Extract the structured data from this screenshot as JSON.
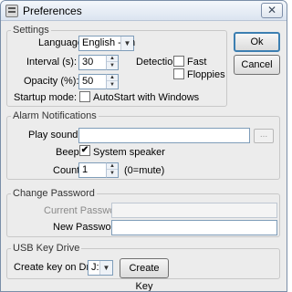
{
  "window": {
    "title": "Preferences",
    "close_glyph": "✕"
  },
  "buttons": {
    "ok_label": "Ok",
    "cancel_label": "Cancel"
  },
  "settings": {
    "legend": "Settings",
    "language_label": "Language:",
    "language_value": "English - en",
    "interval_label": "Interval (s):",
    "interval_value": "30",
    "opacity_label": "Opacity (%):",
    "opacity_value": "50",
    "startup_label": "Startup mode:",
    "autostart_label": "AutoStart with Windows",
    "autostart_checked": false,
    "detection_label": "Detection:",
    "fast_label": "Fast",
    "fast_checked": false,
    "floppies_label": "Floppies",
    "floppies_checked": false
  },
  "alarm": {
    "legend": "Alarm Notifications",
    "play_sound_label": "Play sound file",
    "sound_file_value": "",
    "browse_label": "...",
    "beep_label": "Beep:",
    "beep_checked": true,
    "beep_check_glyph": "✔",
    "system_speaker_label": "System speaker",
    "count_label": "Count:",
    "count_value": "1",
    "count_hint": "(0=mute)"
  },
  "password": {
    "legend": "Change Password",
    "current_label": "Current Password:",
    "new_label": "New Password:"
  },
  "usb": {
    "legend": "USB Key Drive",
    "create_label": "Create key on Drive:",
    "drive_value": "J:",
    "create_button_label": "Create Key"
  }
}
